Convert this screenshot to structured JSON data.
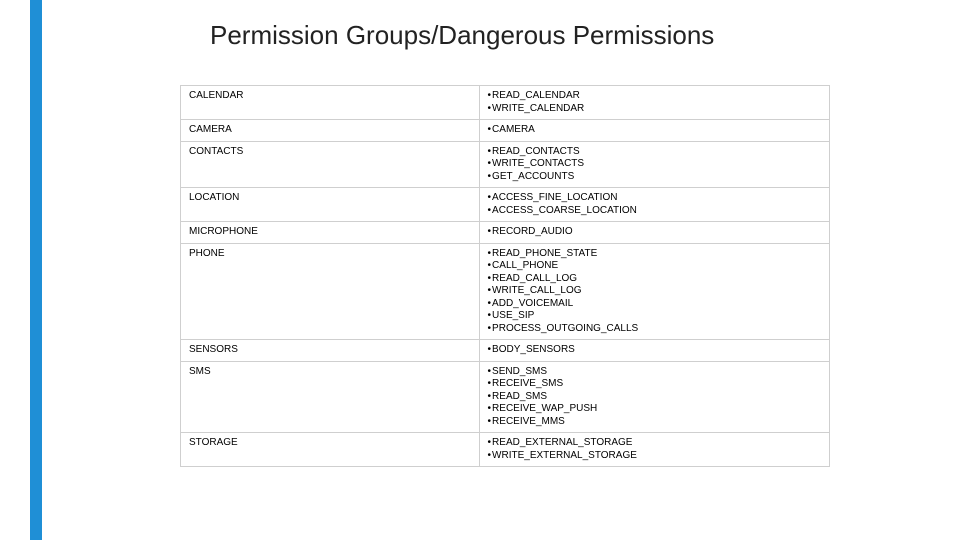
{
  "title": "Permission Groups/Dangerous Permissions",
  "bullet": "•",
  "rows": [
    {
      "group": "CALENDAR",
      "perms": [
        "READ_CALENDAR",
        "WRITE_CALENDAR"
      ]
    },
    {
      "group": "CAMERA",
      "perms": [
        "CAMERA"
      ]
    },
    {
      "group": "CONTACTS",
      "perms": [
        "READ_CONTACTS",
        "WRITE_CONTACTS",
        "GET_ACCOUNTS"
      ]
    },
    {
      "group": "LOCATION",
      "perms": [
        "ACCESS_FINE_LOCATION",
        "ACCESS_COARSE_LOCATION"
      ]
    },
    {
      "group": "MICROPHONE",
      "perms": [
        "RECORD_AUDIO"
      ]
    },
    {
      "group": "PHONE",
      "perms": [
        "READ_PHONE_STATE",
        "CALL_PHONE",
        "READ_CALL_LOG",
        "WRITE_CALL_LOG",
        "ADD_VOICEMAIL",
        "USE_SIP",
        "PROCESS_OUTGOING_CALLS"
      ]
    },
    {
      "group": "SENSORS",
      "perms": [
        "BODY_SENSORS"
      ]
    },
    {
      "group": "SMS",
      "perms": [
        "SEND_SMS",
        "RECEIVE_SMS",
        "READ_SMS",
        "RECEIVE_WAP_PUSH",
        "RECEIVE_MMS"
      ]
    },
    {
      "group": "STORAGE",
      "perms": [
        "READ_EXTERNAL_STORAGE",
        "WRITE_EXTERNAL_STORAGE"
      ]
    }
  ]
}
